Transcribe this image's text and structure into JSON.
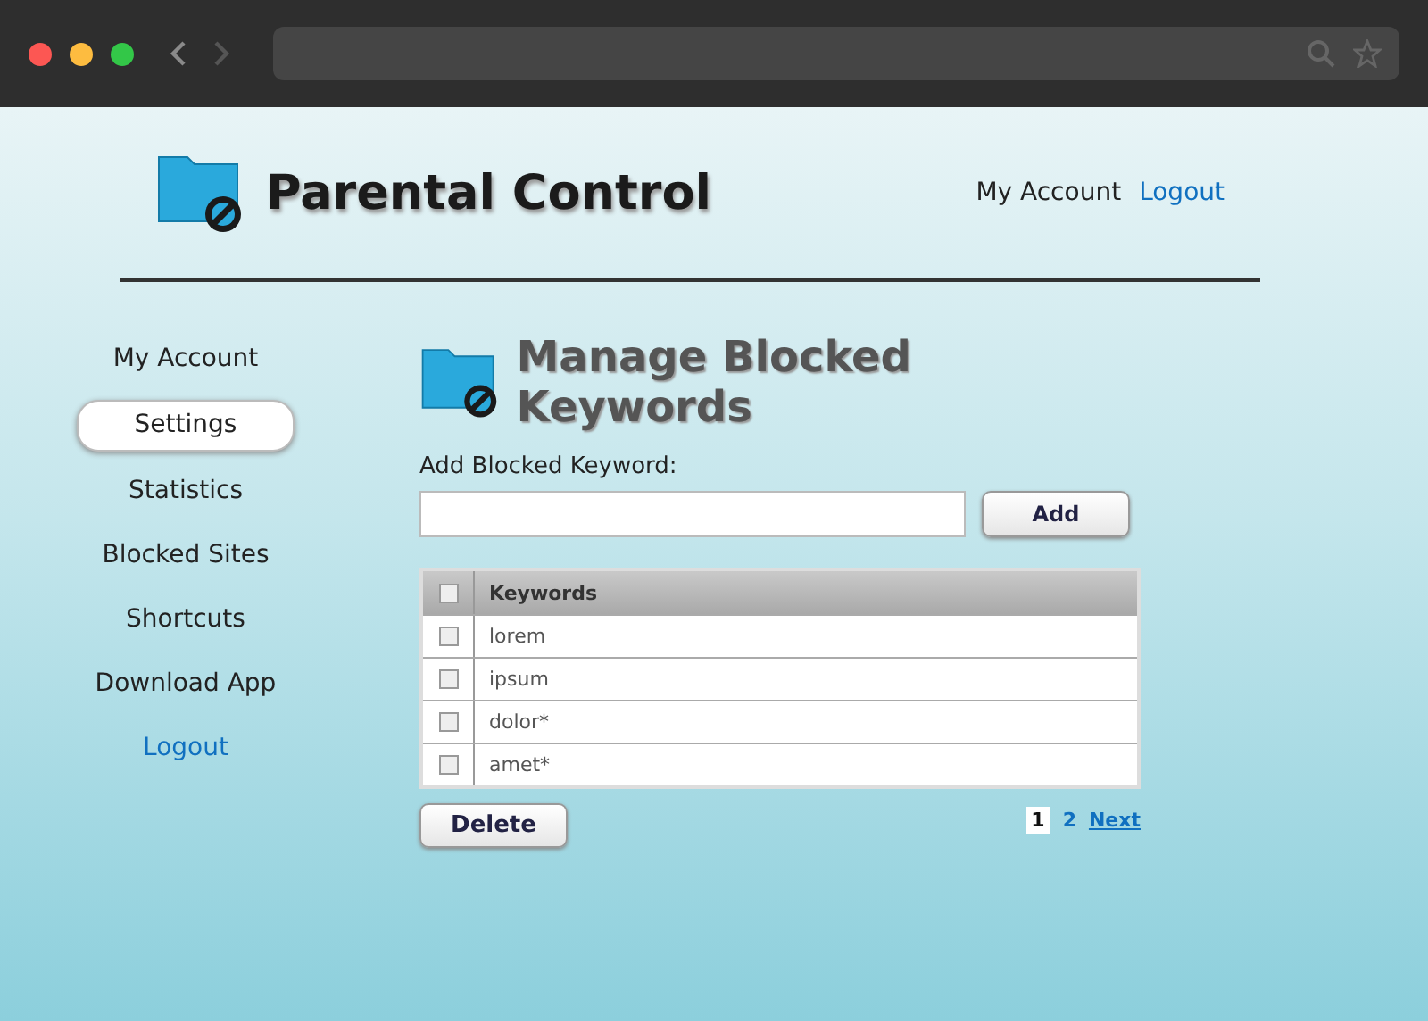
{
  "header": {
    "title": "Parental Control",
    "links": [
      {
        "label": "My Account",
        "kind": "plain"
      },
      {
        "label": "Logout",
        "kind": "accent"
      }
    ]
  },
  "sidebar": {
    "items": [
      {
        "label": "My Account",
        "selected": false,
        "kind": "plain"
      },
      {
        "label": "Settings",
        "selected": true,
        "kind": "plain"
      },
      {
        "label": "Statistics",
        "selected": false,
        "kind": "plain"
      },
      {
        "label": "Blocked Sites",
        "selected": false,
        "kind": "plain"
      },
      {
        "label": "Shortcuts",
        "selected": false,
        "kind": "plain"
      },
      {
        "label": "Download App",
        "selected": false,
        "kind": "plain"
      },
      {
        "label": "Logout",
        "selected": false,
        "kind": "accent"
      }
    ]
  },
  "main": {
    "title": "Manage Blocked Keywords",
    "add_label": "Add Blocked Keyword:",
    "add_button": "Add",
    "table": {
      "header_checked": false,
      "columns": [
        "Keywords"
      ],
      "rows": [
        {
          "keyword": "lorem",
          "checked": false
        },
        {
          "keyword": "ipsum",
          "checked": false
        },
        {
          "keyword": "dolor*",
          "checked": false
        },
        {
          "keyword": "amet*",
          "checked": false
        }
      ]
    },
    "delete_button": "Delete",
    "pagination": {
      "pages": [
        {
          "label": "1",
          "selected": true
        },
        {
          "label": "2",
          "selected": false
        }
      ],
      "next": "Next"
    }
  }
}
